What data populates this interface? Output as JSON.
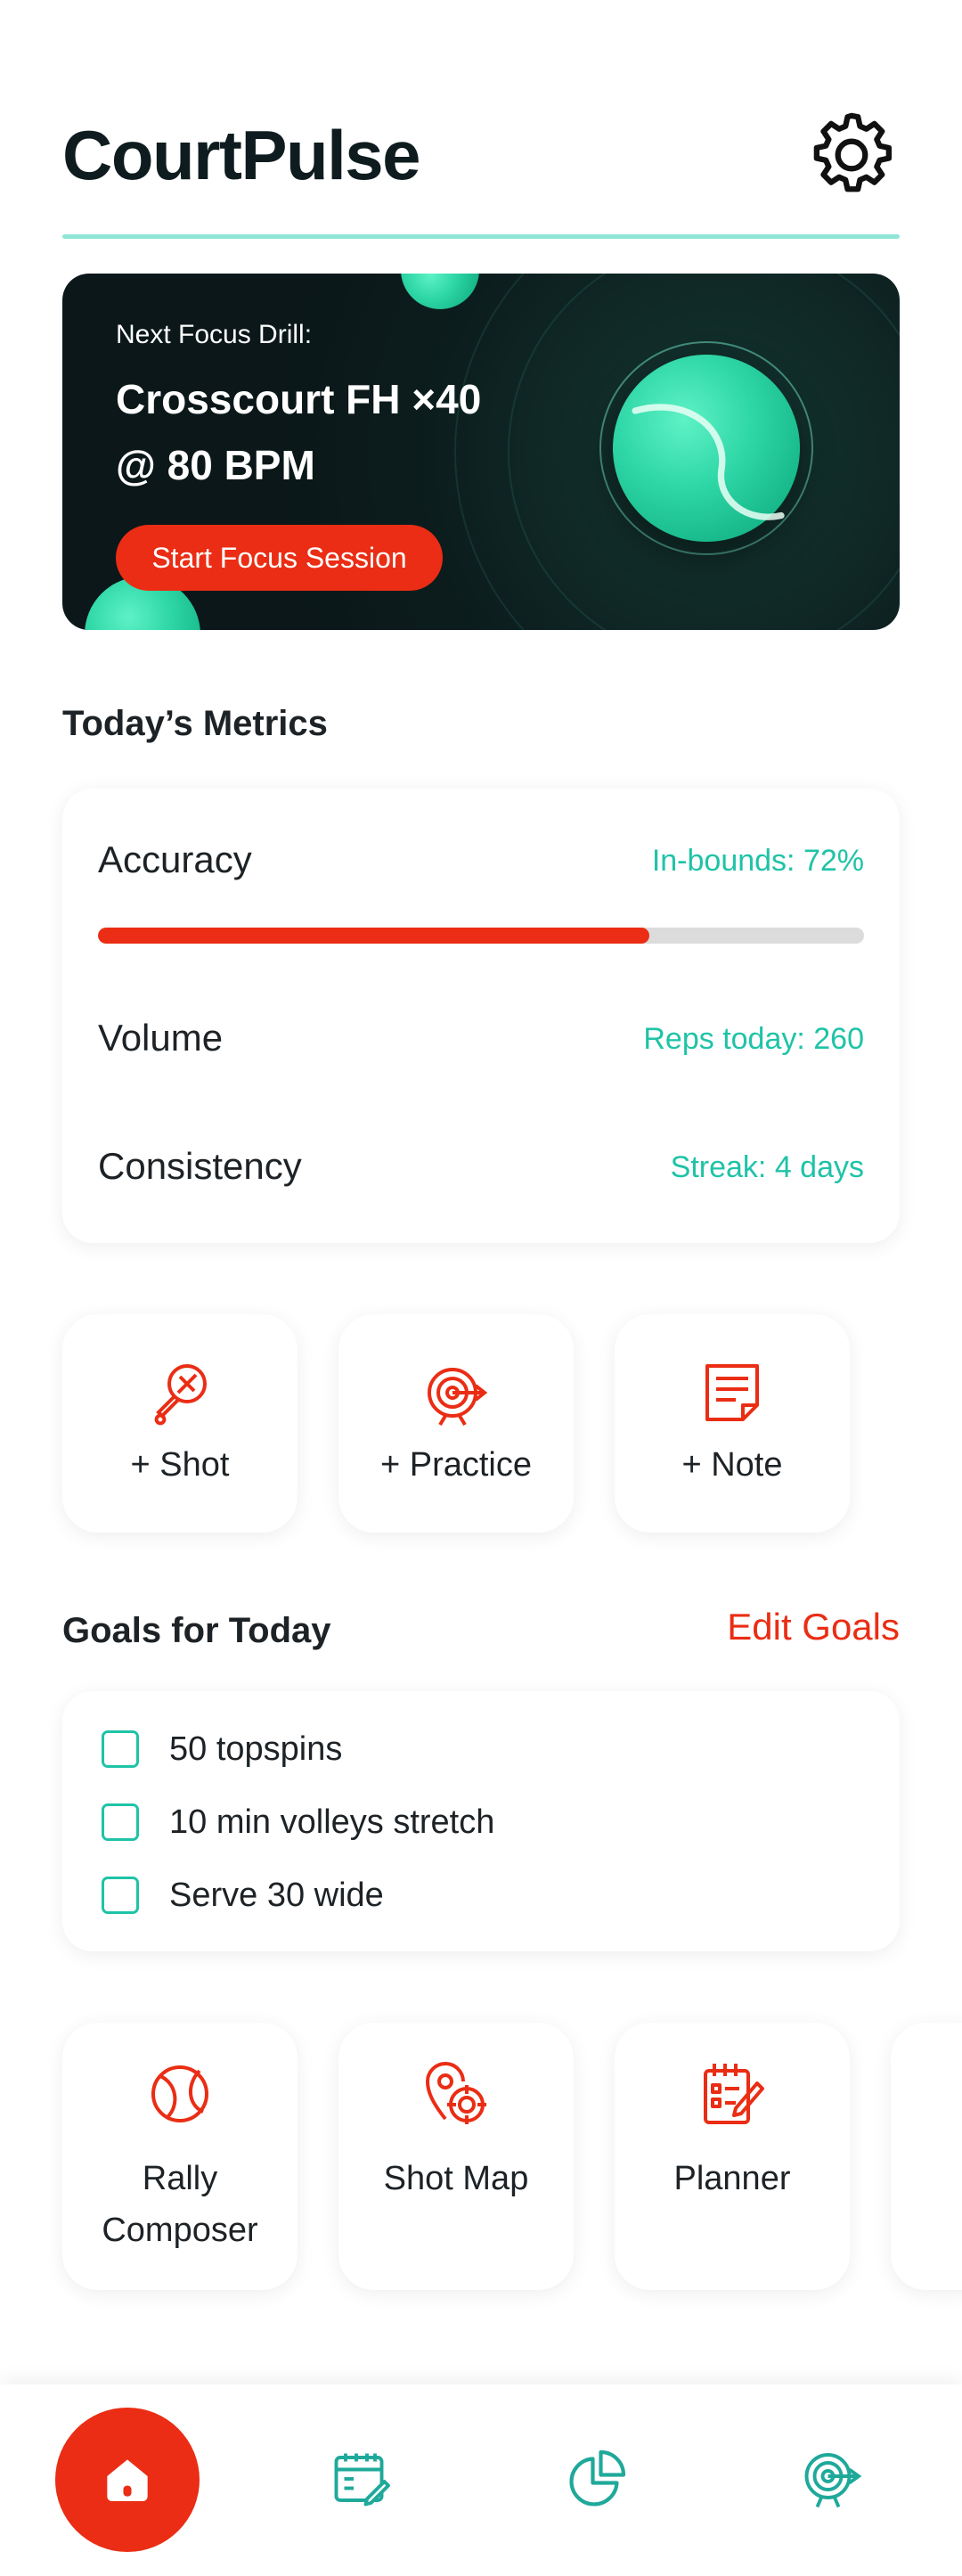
{
  "header": {
    "title": "CourtPulse",
    "settings_icon": "gear-icon"
  },
  "hero": {
    "kicker": "Next Focus Drill:",
    "title": "Crosscourt FH ×40 @ 80 BPM",
    "cta_label": "Start Focus Session",
    "illustration": "tennis-ball"
  },
  "metrics": {
    "section_title": "Today’s Metrics",
    "items": [
      {
        "label": "Accuracy",
        "value": "In-bounds: 72%",
        "progress": 0.72
      },
      {
        "label": "Volume",
        "value": "Reps today: 260"
      },
      {
        "label": "Consistency",
        "value": "Streak: 4 days"
      }
    ]
  },
  "quick_add": [
    {
      "label": "+ Shot",
      "icon": "racket-icon"
    },
    {
      "label": "+ Practice",
      "icon": "target-icon"
    },
    {
      "label": "+ Note",
      "icon": "note-icon"
    }
  ],
  "goals": {
    "section_title": "Goals for Today",
    "edit_label": "Edit Goals",
    "items": [
      {
        "text": "50 topspins",
        "checked": false
      },
      {
        "text": "10 min volleys stretch",
        "checked": false
      },
      {
        "text": "Serve 30 wide",
        "checked": false
      }
    ]
  },
  "tools": [
    {
      "label": "Rally Composer",
      "icon": "tennis-ball-icon"
    },
    {
      "label": "Shot Map",
      "icon": "map-pin-target-icon"
    },
    {
      "label": "Planner",
      "icon": "planner-icon"
    }
  ],
  "nav": {
    "items": [
      {
        "name": "home",
        "icon": "home-icon",
        "active": true
      },
      {
        "name": "calendar",
        "icon": "calendar-edit-icon"
      },
      {
        "name": "stats",
        "icon": "pie-chart-icon"
      },
      {
        "name": "goals",
        "icon": "target-icon"
      }
    ]
  },
  "colors": {
    "accent_red": "#ea2d14",
    "accent_teal": "#1fc3a7",
    "hero_bg": "#0c1d1d",
    "text": "#1d2226"
  }
}
